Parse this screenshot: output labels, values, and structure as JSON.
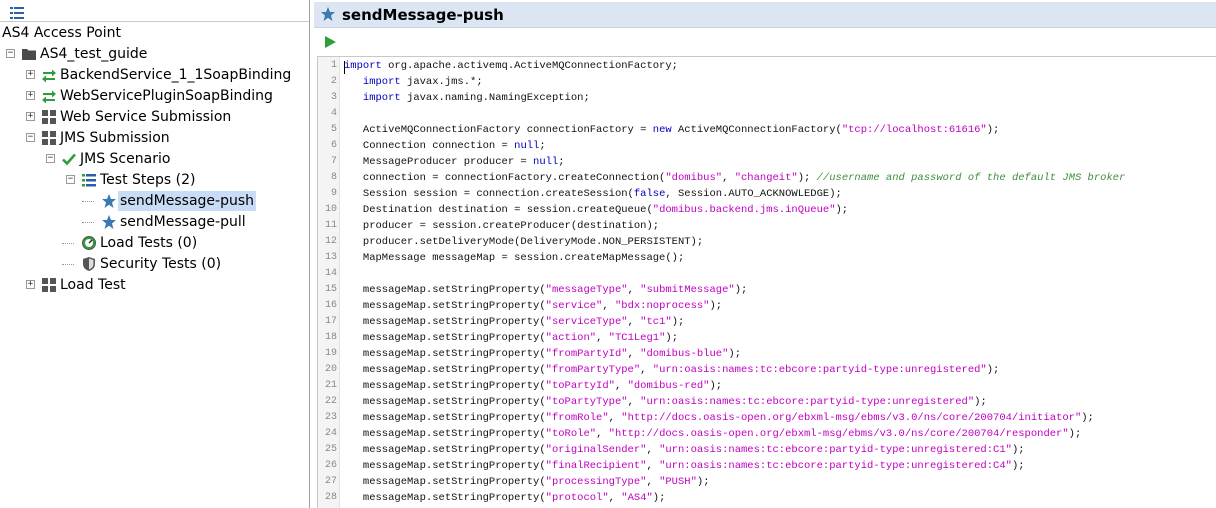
{
  "app": {
    "title": "AS4 Access Point"
  },
  "tree": {
    "root": "AS4 Access Point",
    "items": [
      {
        "label": "AS4_test_guide",
        "icon": "folder-icon",
        "expanded": true
      },
      {
        "label": "BackendService_1_1SoapBinding",
        "icon": "interface-arrows-icon",
        "expanded": false
      },
      {
        "label": "WebServicePluginSoapBinding",
        "icon": "interface-arrows-icon",
        "expanded": false
      },
      {
        "label": "Web Service Submission",
        "icon": "grid-icon",
        "expanded": false
      },
      {
        "label": "JMS Submission",
        "icon": "grid-icon",
        "expanded": true
      },
      {
        "label": "JMS Scenario",
        "icon": "checkmark-icon",
        "expanded": true
      },
      {
        "label": "Test Steps (2)",
        "icon": "list-icon",
        "expanded": true
      },
      {
        "label": "sendMessage-push",
        "icon": "star-icon",
        "selected": true
      },
      {
        "label": "sendMessage-pull",
        "icon": "star-icon"
      },
      {
        "label": "Load Tests (0)",
        "icon": "gauge-icon"
      },
      {
        "label": "Security Tests (0)",
        "icon": "shield-icon"
      },
      {
        "label": "Load Test",
        "icon": "grid-icon",
        "expanded": false
      }
    ]
  },
  "editor": {
    "tab_title": "sendMessage-push",
    "run_label": "Run",
    "lines": [
      [
        {
          "t": "import",
          "c": "kw"
        },
        {
          "t": " org.apache.activemq.ActiveMQConnectionFactory;"
        }
      ],
      [
        {
          "t": "   "
        },
        {
          "t": "import",
          "c": "kw"
        },
        {
          "t": " javax.jms.*;"
        }
      ],
      [
        {
          "t": "   "
        },
        {
          "t": "import",
          "c": "kw"
        },
        {
          "t": " javax.naming.NamingException;"
        }
      ],
      [],
      [
        {
          "t": "   ActiveMQConnectionFactory connectionFactory = "
        },
        {
          "t": "new",
          "c": "kw"
        },
        {
          "t": " ActiveMQConnectionFactory("
        },
        {
          "t": "\"tcp://localhost:61616\"",
          "c": "str"
        },
        {
          "t": ");"
        }
      ],
      [
        {
          "t": "   Connection connection = "
        },
        {
          "t": "null",
          "c": "kw"
        },
        {
          "t": ";"
        }
      ],
      [
        {
          "t": "   MessageProducer producer = "
        },
        {
          "t": "null",
          "c": "kw"
        },
        {
          "t": ";"
        }
      ],
      [
        {
          "t": "   connection = connectionFactory.createConnection("
        },
        {
          "t": "\"domibus\"",
          "c": "str"
        },
        {
          "t": ", "
        },
        {
          "t": "\"changeit\"",
          "c": "str"
        },
        {
          "t": "); "
        },
        {
          "t": "//username and password of the default JMS broker",
          "c": "cmt"
        }
      ],
      [
        {
          "t": "   Session session = connection.createSession("
        },
        {
          "t": "false",
          "c": "kw"
        },
        {
          "t": ", Session.AUTO_ACKNOWLEDGE);"
        }
      ],
      [
        {
          "t": "   Destination destination = session.createQueue("
        },
        {
          "t": "\"domibus.backend.jms.inQueue\"",
          "c": "str"
        },
        {
          "t": ");"
        }
      ],
      [
        {
          "t": "   producer = session.createProducer(destination);"
        }
      ],
      [
        {
          "t": "   producer.setDeliveryMode(DeliveryMode.NON_PERSISTENT);"
        }
      ],
      [
        {
          "t": "   MapMessage messageMap = session.createMapMessage();"
        }
      ],
      [],
      [
        {
          "t": "   messageMap.setStringProperty("
        },
        {
          "t": "\"messageType\"",
          "c": "str"
        },
        {
          "t": ", "
        },
        {
          "t": "\"submitMessage\"",
          "c": "str"
        },
        {
          "t": ");"
        }
      ],
      [
        {
          "t": "   messageMap.setStringProperty("
        },
        {
          "t": "\"service\"",
          "c": "str"
        },
        {
          "t": ", "
        },
        {
          "t": "\"bdx:noprocess\"",
          "c": "str"
        },
        {
          "t": ");"
        }
      ],
      [
        {
          "t": "   messageMap.setStringProperty("
        },
        {
          "t": "\"serviceType\"",
          "c": "str"
        },
        {
          "t": ", "
        },
        {
          "t": "\"tc1\"",
          "c": "str"
        },
        {
          "t": ");"
        }
      ],
      [
        {
          "t": "   messageMap.setStringProperty("
        },
        {
          "t": "\"action\"",
          "c": "str"
        },
        {
          "t": ", "
        },
        {
          "t": "\"TC1Leg1\"",
          "c": "str"
        },
        {
          "t": ");"
        }
      ],
      [
        {
          "t": "   messageMap.setStringProperty("
        },
        {
          "t": "\"fromPartyId\"",
          "c": "str"
        },
        {
          "t": ", "
        },
        {
          "t": "\"domibus-blue\"",
          "c": "str"
        },
        {
          "t": ");"
        }
      ],
      [
        {
          "t": "   messageMap.setStringProperty("
        },
        {
          "t": "\"fromPartyType\"",
          "c": "str"
        },
        {
          "t": ", "
        },
        {
          "t": "\"urn:oasis:names:tc:ebcore:partyid-type:unregistered\"",
          "c": "str"
        },
        {
          "t": ");"
        }
      ],
      [
        {
          "t": "   messageMap.setStringProperty("
        },
        {
          "t": "\"toPartyId\"",
          "c": "str"
        },
        {
          "t": ", "
        },
        {
          "t": "\"domibus-red\"",
          "c": "str"
        },
        {
          "t": ");"
        }
      ],
      [
        {
          "t": "   messageMap.setStringProperty("
        },
        {
          "t": "\"toPartyType\"",
          "c": "str"
        },
        {
          "t": ", "
        },
        {
          "t": "\"urn:oasis:names:tc:ebcore:partyid-type:unregistered\"",
          "c": "str"
        },
        {
          "t": ");"
        }
      ],
      [
        {
          "t": "   messageMap.setStringProperty("
        },
        {
          "t": "\"fromRole\"",
          "c": "str"
        },
        {
          "t": ", "
        },
        {
          "t": "\"http://docs.oasis-open.org/ebxml-msg/ebms/v3.0/ns/core/200704/initiator\"",
          "c": "str"
        },
        {
          "t": ");"
        }
      ],
      [
        {
          "t": "   messageMap.setStringProperty("
        },
        {
          "t": "\"toRole\"",
          "c": "str"
        },
        {
          "t": ", "
        },
        {
          "t": "\"http://docs.oasis-open.org/ebxml-msg/ebms/v3.0/ns/core/200704/responder\"",
          "c": "str"
        },
        {
          "t": ");"
        }
      ],
      [
        {
          "t": "   messageMap.setStringProperty("
        },
        {
          "t": "\"originalSender\"",
          "c": "str"
        },
        {
          "t": ", "
        },
        {
          "t": "\"urn:oasis:names:tc:ebcore:partyid-type:unregistered:C1\"",
          "c": "str"
        },
        {
          "t": ");"
        }
      ],
      [
        {
          "t": "   messageMap.setStringProperty("
        },
        {
          "t": "\"finalRecipient\"",
          "c": "str"
        },
        {
          "t": ", "
        },
        {
          "t": "\"urn:oasis:names:tc:ebcore:partyid-type:unregistered:C4\"",
          "c": "str"
        },
        {
          "t": ");"
        }
      ],
      [
        {
          "t": "   messageMap.setStringProperty("
        },
        {
          "t": "\"processingType\"",
          "c": "str"
        },
        {
          "t": ", "
        },
        {
          "t": "\"PUSH\"",
          "c": "str"
        },
        {
          "t": ");"
        }
      ],
      [
        {
          "t": "   messageMap.setStringProperty("
        },
        {
          "t": "\"protocol\"",
          "c": "str"
        },
        {
          "t": ", "
        },
        {
          "t": "\"AS4\"",
          "c": "str"
        },
        {
          "t": ");"
        }
      ]
    ]
  },
  "colors": {
    "selection": "#c9dcf5",
    "tab_header": "#dbe6f2",
    "keyword": "#0000c0",
    "string": "#c000c0",
    "comment": "#3f8f3f",
    "accent_green": "#2e9e3a",
    "star_blue": "#3a7ab3"
  }
}
